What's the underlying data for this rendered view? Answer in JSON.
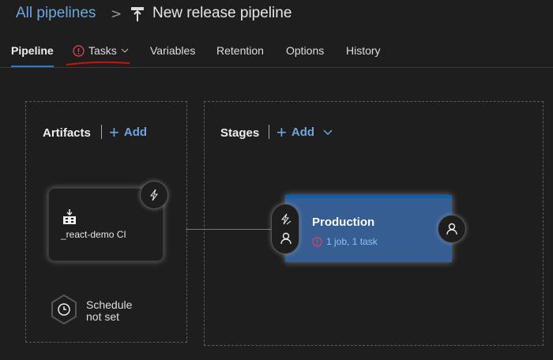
{
  "breadcrumb": {
    "root": "All pipelines",
    "separator": ">",
    "title": "New release pipeline"
  },
  "tabs": [
    {
      "label": "Pipeline"
    },
    {
      "label": "Tasks"
    },
    {
      "label": "Variables"
    },
    {
      "label": "Retention"
    },
    {
      "label": "Options"
    },
    {
      "label": "History"
    }
  ],
  "artifacts": {
    "header": "Artifacts",
    "add": "Add",
    "item": "_react-demo CI",
    "schedule_line1": "Schedule",
    "schedule_line2": "not set"
  },
  "stages": {
    "header": "Stages",
    "add": "Add",
    "stage_name": "Production",
    "stage_summary": "1 job, 1 task"
  },
  "colors": {
    "accent": "#6ea6e0",
    "stage": "#375e93",
    "error": "#e0445a"
  }
}
